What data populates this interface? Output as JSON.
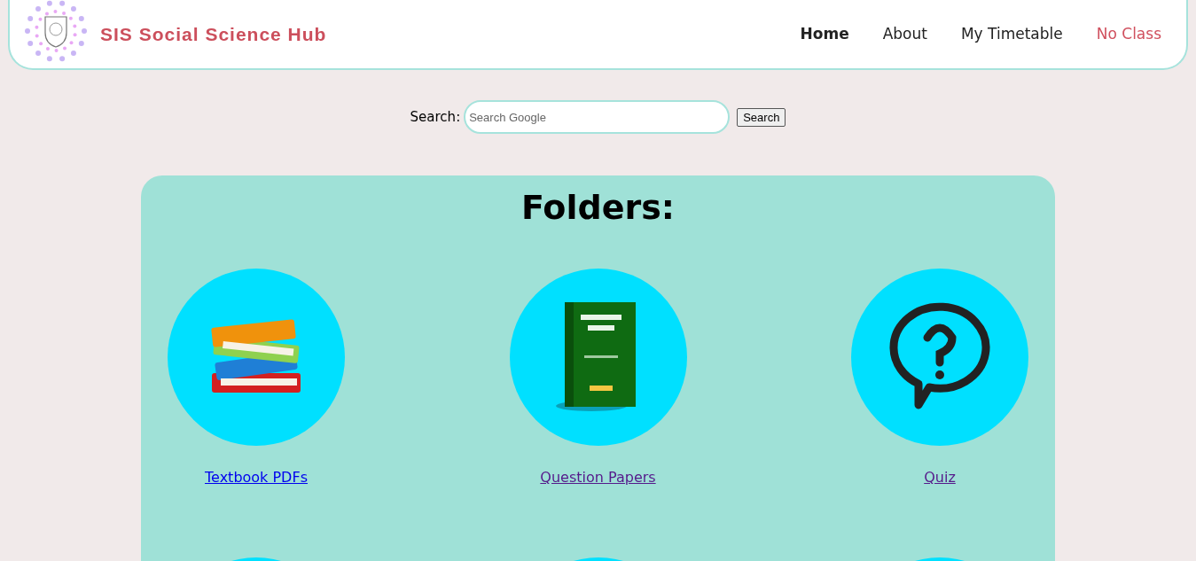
{
  "header": {
    "brand": "SIS Social Science Hub",
    "nav": [
      {
        "label": "Home",
        "selected": true,
        "kind": "link"
      },
      {
        "label": "About",
        "selected": false,
        "kind": "link"
      },
      {
        "label": "My Timetable",
        "selected": false,
        "kind": "link"
      },
      {
        "label": "No Class",
        "selected": false,
        "kind": "alert"
      }
    ]
  },
  "search": {
    "label": "Search:",
    "placeholder": "Search Google",
    "button": "Search"
  },
  "folders": {
    "title": "Folders:",
    "items": [
      {
        "label": "Textbook PDFs",
        "kind": "books"
      },
      {
        "label": "Question Papers",
        "kind": "bank"
      },
      {
        "label": "Quiz",
        "kind": "quiz"
      },
      {
        "kind": "picture"
      },
      {
        "kind": "picture"
      },
      {
        "kind": "picture"
      }
    ]
  }
}
